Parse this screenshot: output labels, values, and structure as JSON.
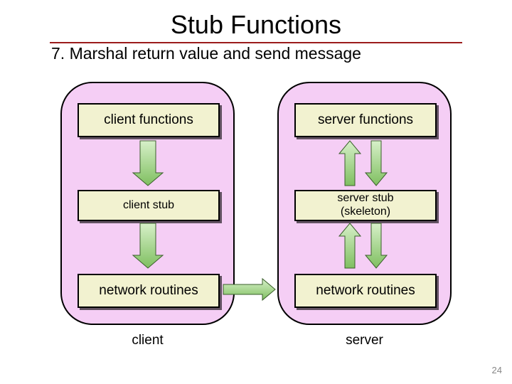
{
  "title": "Stub Functions",
  "step": "7. Marshal return value and send message",
  "client": {
    "box1": "client functions",
    "box2": "client stub",
    "box3": "network routines",
    "caption": "client"
  },
  "server": {
    "box1": "server functions",
    "box2_line1": "server stub",
    "box2_line2": "(skeleton)",
    "box3": "network routines",
    "caption": "server"
  },
  "slide_number": "24"
}
